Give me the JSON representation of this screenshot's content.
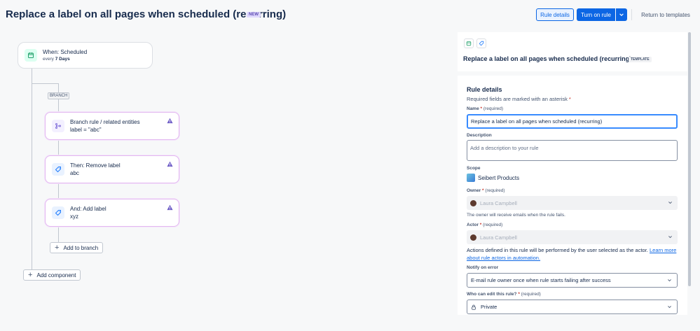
{
  "header": {
    "title": "Replace a label on all pages when scheduled (recurring)",
    "new_badge": "NEW",
    "rule_details_button": "Rule details",
    "turn_on_button": "Turn on rule",
    "return_button": "Return to templates"
  },
  "canvas": {
    "trigger": {
      "title": "When: Scheduled",
      "sub_prefix": "every",
      "sub_value": "7 Days"
    },
    "branch_label": "BRANCH",
    "branch_rule": {
      "title": "Branch rule / related entities",
      "value": "label = \"abc\""
    },
    "remove_label": {
      "title": "Then: Remove label",
      "value": "abc"
    },
    "add_label": {
      "title": "And: Add label",
      "value": "xyz"
    },
    "add_to_branch": "Add to branch",
    "add_component": "Add component"
  },
  "panel": {
    "title": "Replace a label on all pages when scheduled (recurring)",
    "template_badge": "TEMPLATE",
    "section_title": "Rule details",
    "required_note": "Required fields are marked with an asterisk",
    "asterisk": "*",
    "name_label": "Name",
    "name_required": "(required)",
    "name_value": "Replace a label on all pages when scheduled (recurring)",
    "description_label": "Description",
    "description_placeholder": "Add a description to your rule",
    "scope_label": "Scope",
    "scope_value": "Seibert Products",
    "owner_label": "Owner",
    "owner_required": "(required)",
    "owner_value": "Laura Campbell",
    "owner_help": "The owner will receive emails when the rule fails.",
    "actor_label": "Actor",
    "actor_required": "(required)",
    "actor_value": "Laura Campbell",
    "actor_help": "Actions defined in this rule will be performed by the user selected as the actor.",
    "actor_link": "Learn more about rule actors in automation.",
    "notify_label": "Notify on error",
    "notify_value": "E-mail rule owner once when rule starts failing after success",
    "who_edit_label": "Who can edit this rule?",
    "who_edit_required": "(required)",
    "who_edit_value": "Private"
  },
  "colors": {
    "primary": "#0c66e4",
    "branch_border": "#e2b8f0",
    "warning_icon": "#6e5dc6",
    "new_badge_bg": "#dfd8fd"
  }
}
